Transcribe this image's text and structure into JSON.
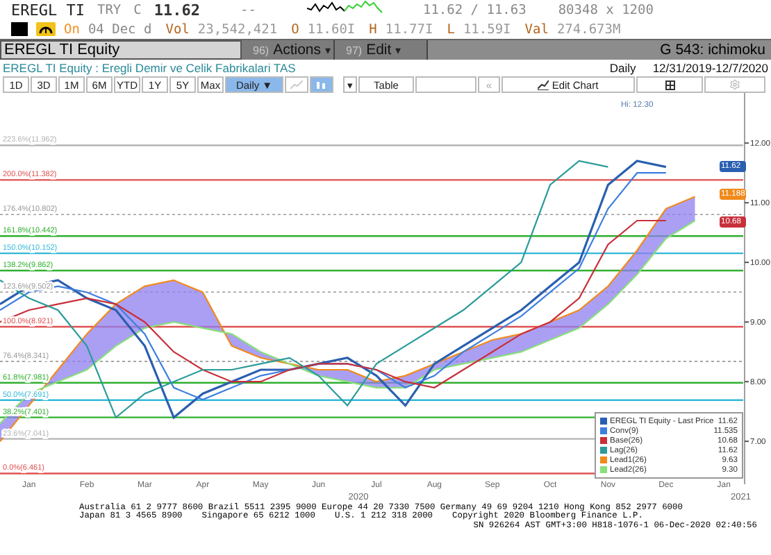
{
  "quote": {
    "ticker": "EREGL TI",
    "currency": "TRY",
    "price_type": "C",
    "last": "11.62",
    "change": "--",
    "bid_ask": "11.62 / 11.63",
    "size": "80348 x 1200"
  },
  "session": {
    "status": "On",
    "date": "04 Dec d",
    "stats": [
      {
        "label": "Vol",
        "value": "23,542,421"
      },
      {
        "label": "O",
        "value": "11.60I"
      },
      {
        "label": "H",
        "value": "11.77I"
      },
      {
        "label": "L",
        "value": "11.59I"
      },
      {
        "label": "Val",
        "value": "274.673M"
      }
    ]
  },
  "command_bar": {
    "security": "EREGL TI Equity",
    "menus": [
      {
        "number": "96)",
        "label": "Actions",
        "arrow": "▾"
      },
      {
        "number": "97)",
        "label": "Edit",
        "arrow": "▾"
      }
    ],
    "function": "G 543: ichimoku"
  },
  "title_bar": {
    "description": "EREGL TI Equity : Eregli Demir ve Celik Fabrikalari TAS",
    "frequency": "Daily",
    "range": "12/31/2019-12/7/2020"
  },
  "toolbar": {
    "ranges": [
      {
        "label": "1D",
        "selected": false
      },
      {
        "label": "3D",
        "selected": false
      },
      {
        "label": "1M",
        "selected": false
      },
      {
        "label": "6M",
        "selected": false
      },
      {
        "label": "YTD",
        "selected": false
      },
      {
        "label": "1Y",
        "selected": false
      },
      {
        "label": "5Y",
        "selected": false
      },
      {
        "label": "Max",
        "selected": false
      }
    ],
    "frequency": {
      "label": "Daily",
      "arrow": "▼",
      "selected": true
    },
    "chart_types": [
      {
        "kind": "line",
        "selected": false
      },
      {
        "kind": "candle",
        "selected": true
      }
    ],
    "dropdown_arrow": "▾",
    "table": "Table",
    "back": "«",
    "edit_chart": "Edit Chart"
  },
  "chart": {
    "chart_data": {
      "type": "line",
      "ylim": [
        6.42,
        12.84
      ],
      "categories": [
        null,
        "Jan",
        null,
        "Feb",
        null,
        "Mar",
        null,
        "Apr",
        null,
        "May",
        null,
        "Jun",
        null,
        "Jul",
        null,
        "Aug",
        null,
        "Sep",
        null,
        "Oct",
        null,
        "Nov",
        null,
        "Dec",
        null,
        "Jan"
      ],
      "yticks": [
        {
          "value": 7,
          "label": "7.00"
        },
        {
          "value": 8,
          "label": "8.00"
        },
        {
          "value": 9,
          "label": "9.00"
        },
        {
          "value": 10,
          "label": "10.00"
        },
        {
          "value": 11,
          "label": "11.00"
        },
        {
          "value": 12,
          "label": "12.00"
        }
      ],
      "series": [
        {
          "name": "EREGL TI Equity - Last Price",
          "color": "#2a5fb0",
          "values": [
            9.3,
            9.6,
            9.7,
            9.4,
            9.2,
            8.6,
            7.4,
            7.8,
            8.0,
            8.2,
            8.2,
            8.3,
            8.4,
            8.1,
            7.6,
            8.3,
            8.6,
            8.9,
            9.2,
            9.6,
            10.0,
            11.3,
            11.7,
            11.6,
            null,
            null
          ]
        },
        {
          "name": "Conv(9)",
          "color": "#3d7fe0",
          "values": [
            9.2,
            9.5,
            9.6,
            9.5,
            9.3,
            8.8,
            7.9,
            7.7,
            7.9,
            8.1,
            8.2,
            8.3,
            8.3,
            8.2,
            7.9,
            8.1,
            8.5,
            8.8,
            9.1,
            9.5,
            9.9,
            10.9,
            11.5,
            11.5,
            null,
            null
          ]
        },
        {
          "name": "Base(26)",
          "color": "#c8303a",
          "values": [
            9.0,
            9.2,
            9.3,
            9.4,
            9.3,
            9.0,
            8.5,
            8.2,
            8.0,
            8.0,
            8.2,
            8.3,
            8.3,
            8.2,
            8.0,
            7.9,
            8.2,
            8.5,
            8.8,
            9.0,
            9.4,
            10.3,
            10.7,
            10.7,
            null,
            null
          ]
        },
        {
          "name": "Lag(26)",
          "color": "#2a9a9a",
          "values": [
            9.7,
            9.4,
            9.2,
            8.6,
            7.4,
            7.8,
            8.0,
            8.2,
            8.2,
            8.3,
            8.4,
            8.1,
            7.6,
            8.3,
            8.6,
            8.9,
            9.2,
            9.6,
            10.0,
            11.3,
            11.7,
            11.6,
            null,
            null,
            null,
            null
          ]
        },
        {
          "name": "Lead1(26)",
          "color": "#f08a1c",
          "values": [
            7.0,
            7.6,
            8.2,
            8.8,
            9.3,
            9.6,
            9.7,
            9.5,
            8.6,
            8.4,
            8.3,
            8.2,
            8.2,
            8.0,
            8.1,
            8.3,
            8.5,
            8.7,
            8.8,
            9.0,
            9.2,
            9.6,
            10.2,
            10.9,
            11.1,
            null
          ]
        },
        {
          "name": "Lead2(26)",
          "color": "#88e07a",
          "values": [
            7.3,
            7.8,
            8.0,
            8.2,
            8.6,
            8.9,
            9.0,
            8.9,
            8.8,
            8.5,
            8.3,
            8.1,
            8.0,
            7.9,
            7.9,
            8.2,
            8.3,
            8.4,
            8.5,
            8.7,
            8.9,
            9.3,
            9.8,
            10.4,
            10.7,
            null
          ]
        }
      ],
      "ref_lines": [
        {
          "axis": "y",
          "value": 11.962,
          "label": "223.6%(11.962)",
          "color": "#b4b4b4"
        },
        {
          "axis": "y",
          "value": 11.382,
          "label": "200.0%(11.382)",
          "color": "#e05050"
        },
        {
          "axis": "y",
          "value": 10.802,
          "label": "176.4%(10.802)",
          "color": "#999999"
        },
        {
          "axis": "y",
          "value": 10.442,
          "label": "161.8%(10.442)",
          "color": "#30b030"
        },
        {
          "axis": "y",
          "value": 10.152,
          "label": "150.0%(10.152)",
          "color": "#30b8d8"
        },
        {
          "axis": "y",
          "value": 9.862,
          "label": "138.2%(9.862)",
          "color": "#30b030"
        },
        {
          "axis": "y",
          "value": 9.502,
          "label": "123.6%(9.502)",
          "color": "#999999"
        },
        {
          "axis": "y",
          "value": 8.921,
          "label": "100.0%(8.921)",
          "color": "#e05050"
        },
        {
          "axis": "y",
          "value": 8.341,
          "label": "76.4%(8.341)",
          "color": "#999999"
        },
        {
          "axis": "y",
          "value": 7.981,
          "label": "61.8%(7.981)",
          "color": "#30b030"
        },
        {
          "axis": "y",
          "value": 7.691,
          "label": "50.0%(7.691)",
          "color": "#30b8d8"
        },
        {
          "axis": "y",
          "value": 7.401,
          "label": "38.2%(7.401)",
          "color": "#30b030"
        },
        {
          "axis": "y",
          "value": 7.041,
          "label": "23.6%(7.041)",
          "color": "#b4b4b4"
        },
        {
          "axis": "y",
          "value": 6.461,
          "label": "0.0%(6.461)",
          "color": "#e05050"
        }
      ],
      "annotations": [
        "Hi: 12.30"
      ]
    },
    "price_tags": [
      {
        "label": "11.62",
        "color": "#2a5fb0"
      },
      {
        "label": "11.188",
        "color": "#f08a1c"
      },
      {
        "label": "10.68",
        "color": "#c8303a"
      }
    ],
    "legend": [
      {
        "value": "11.62"
      },
      {
        "value": "11.535"
      },
      {
        "value": "10.68"
      },
      {
        "value": "11.62"
      },
      {
        "value": "9.63"
      },
      {
        "value": "9.30"
      }
    ],
    "years": [
      "2020",
      "2021"
    ]
  },
  "footer": [
    [
      "Australia 61 2 9777 8600 Brazil 5511 2395 9000 Europe 44 20 7330 7500 Germany 49 69 9204 1210 Hong Kong 852 2977 6000"
    ],
    [
      "Japan 81 3 4565 8900",
      "Singapore 65 6212 1000",
      "U.S. 1 212 318 2000",
      "Copyright 2020 Bloomberg Finance L.P."
    ],
    [
      "SN 926264 AST GMT+3:00 H818-1076-1 06-Dec-2020 02:40:56"
    ]
  ]
}
